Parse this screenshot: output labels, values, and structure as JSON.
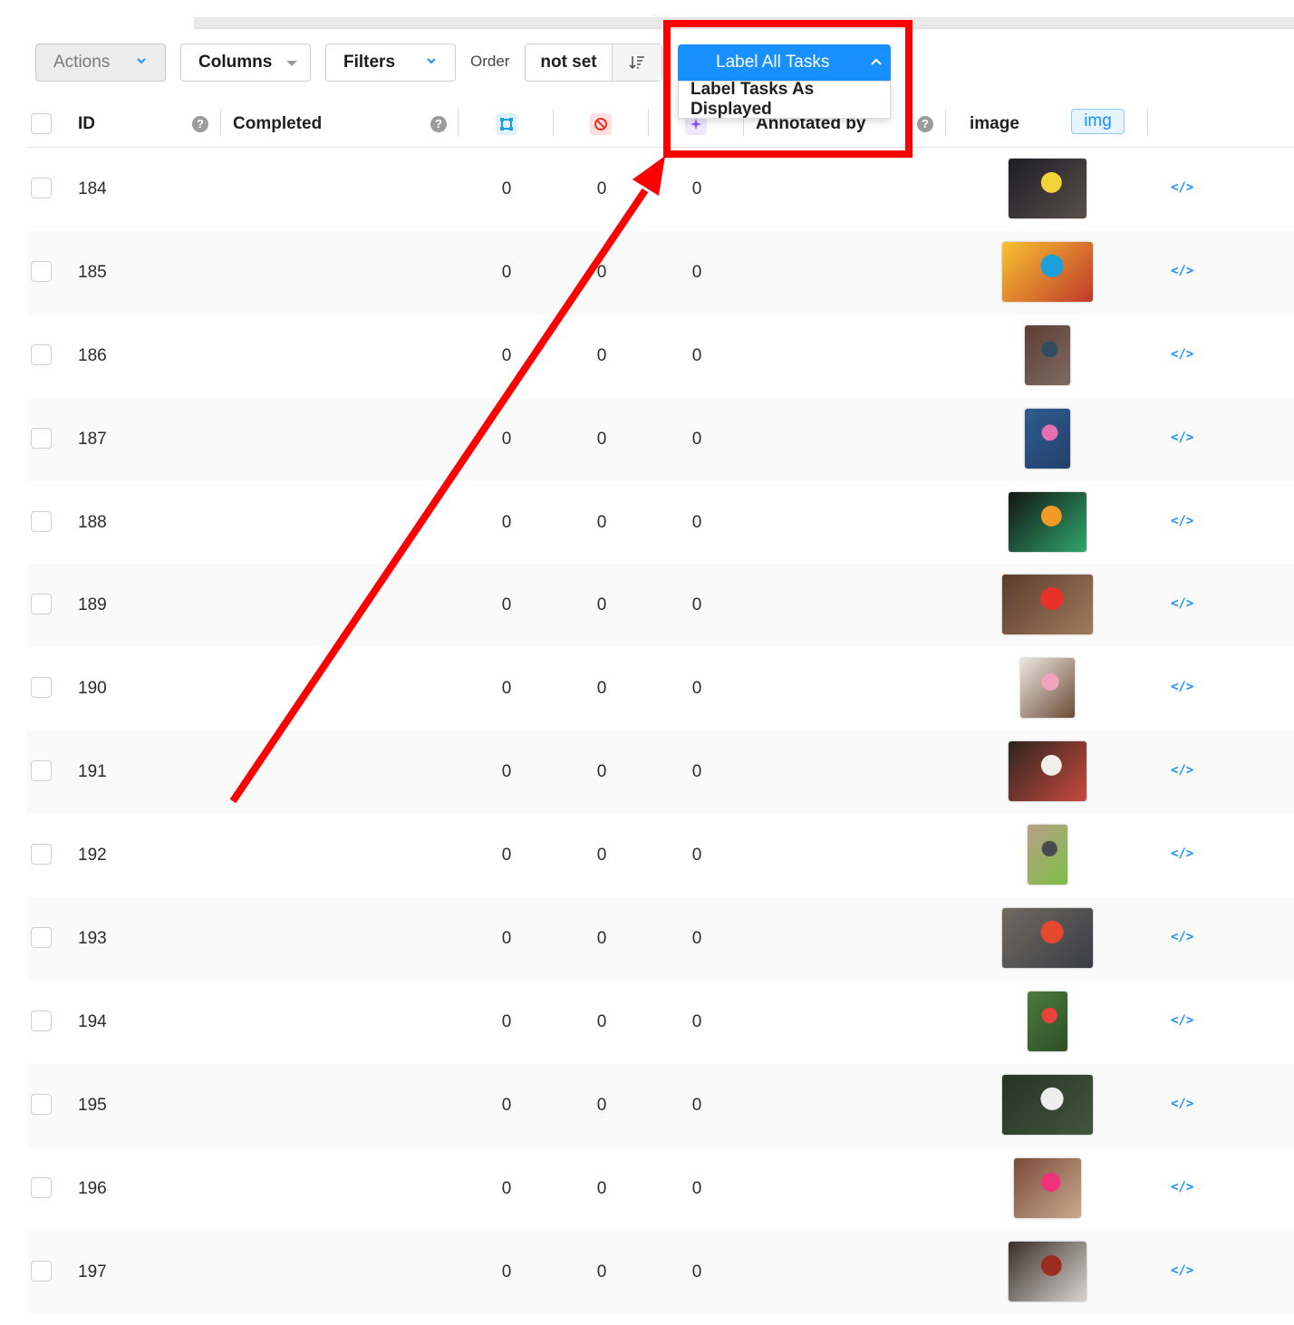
{
  "toolbar": {
    "actions_label": "Actions",
    "columns_label": "Columns",
    "filters_label": "Filters",
    "order_label": "Order",
    "order_value": "not set",
    "label_all_tasks": "Label All Tasks",
    "label_dropdown_item": "Label Tasks As Displayed"
  },
  "header": {
    "id": "ID",
    "completed": "Completed",
    "annotated_by": "Annotated by",
    "image": "image",
    "image_badge": "img",
    "help_glyph": "?"
  },
  "rows": [
    {
      "id": "184",
      "a": "0",
      "b": "0",
      "c": "0",
      "code": "</>",
      "thumb": {
        "colors": [
          "#1d1d28",
          "#f2d43a",
          "#5a4f49"
        ],
        "width": 86
      }
    },
    {
      "id": "185",
      "a": "0",
      "b": "0",
      "c": "0",
      "code": "</>",
      "thumb": {
        "colors": [
          "#f7c230",
          "#1d9fd9",
          "#c0392b"
        ],
        "width": 100
      }
    },
    {
      "id": "186",
      "a": "0",
      "b": "0",
      "c": "0",
      "code": "</>",
      "thumb": {
        "colors": [
          "#5d3d34",
          "#2f4d5c",
          "#7d6c63"
        ],
        "width": 50
      }
    },
    {
      "id": "187",
      "a": "0",
      "b": "0",
      "c": "0",
      "code": "</>",
      "thumb": {
        "colors": [
          "#2e5c8f",
          "#e76fb0",
          "#24406a"
        ],
        "width": 50
      }
    },
    {
      "id": "188",
      "a": "0",
      "b": "0",
      "c": "0",
      "code": "</>",
      "thumb": {
        "colors": [
          "#141414",
          "#f39a26",
          "#2ea76a"
        ],
        "width": 86
      }
    },
    {
      "id": "189",
      "a": "0",
      "b": "0",
      "c": "0",
      "code": "</>",
      "thumb": {
        "colors": [
          "#5b3c2d",
          "#e9302a",
          "#a07a5c"
        ],
        "width": 100
      }
    },
    {
      "id": "190",
      "a": "0",
      "b": "0",
      "c": "0",
      "code": "</>",
      "thumb": {
        "colors": [
          "#ece8e2",
          "#f2a3bd",
          "#6d4b36"
        ],
        "width": 60
      }
    },
    {
      "id": "191",
      "a": "0",
      "b": "0",
      "c": "0",
      "code": "</>",
      "thumb": {
        "colors": [
          "#2d2520",
          "#f1efe7",
          "#c94a3e"
        ],
        "width": 86
      }
    },
    {
      "id": "192",
      "a": "0",
      "b": "0",
      "c": "0",
      "code": "</>",
      "thumb": {
        "colors": [
          "#b79f86",
          "#4a4a52",
          "#7dbe45"
        ],
        "width": 44
      }
    },
    {
      "id": "193",
      "a": "0",
      "b": "0",
      "c": "0",
      "code": "</>",
      "thumb": {
        "colors": [
          "#6f6a61",
          "#e6482e",
          "#3b3d45"
        ],
        "width": 100
      }
    },
    {
      "id": "194",
      "a": "0",
      "b": "0",
      "c": "0",
      "code": "</>",
      "thumb": {
        "colors": [
          "#4b7b3d",
          "#e8423a",
          "#2f4e29"
        ],
        "width": 44
      }
    },
    {
      "id": "195",
      "a": "0",
      "b": "0",
      "c": "0",
      "code": "</>",
      "thumb": {
        "colors": [
          "#243523",
          "#eeeeee",
          "#44553e"
        ],
        "width": 100
      }
    },
    {
      "id": "196",
      "a": "0",
      "b": "0",
      "c": "0",
      "code": "</>",
      "thumb": {
        "colors": [
          "#7b4b3a",
          "#f0307b",
          "#c9a98d"
        ],
        "width": 74
      }
    },
    {
      "id": "197",
      "a": "0",
      "b": "0",
      "c": "0",
      "code": "</>",
      "thumb": {
        "colors": [
          "#3a2f28",
          "#9b2c20",
          "#d9d5cf"
        ],
        "width": 86
      }
    }
  ],
  "colors": {
    "accent": "#1890ff",
    "highlight": "#ff0000",
    "annotations_icon": "#1ba1e2",
    "cancelled_icon": "#e6332a",
    "predictions_icon": "#8a5cf6"
  },
  "icons": {
    "actions": "chevron-down-icon",
    "columns": "caret-down-icon",
    "filters": "chevron-down-icon",
    "order": "sort-descending-icon",
    "label_all": "chevron-up-icon",
    "annotations": "annotations-icon",
    "cancelled": "cancelled-icon",
    "predictions": "predictions-icon",
    "code": "code-icon"
  }
}
